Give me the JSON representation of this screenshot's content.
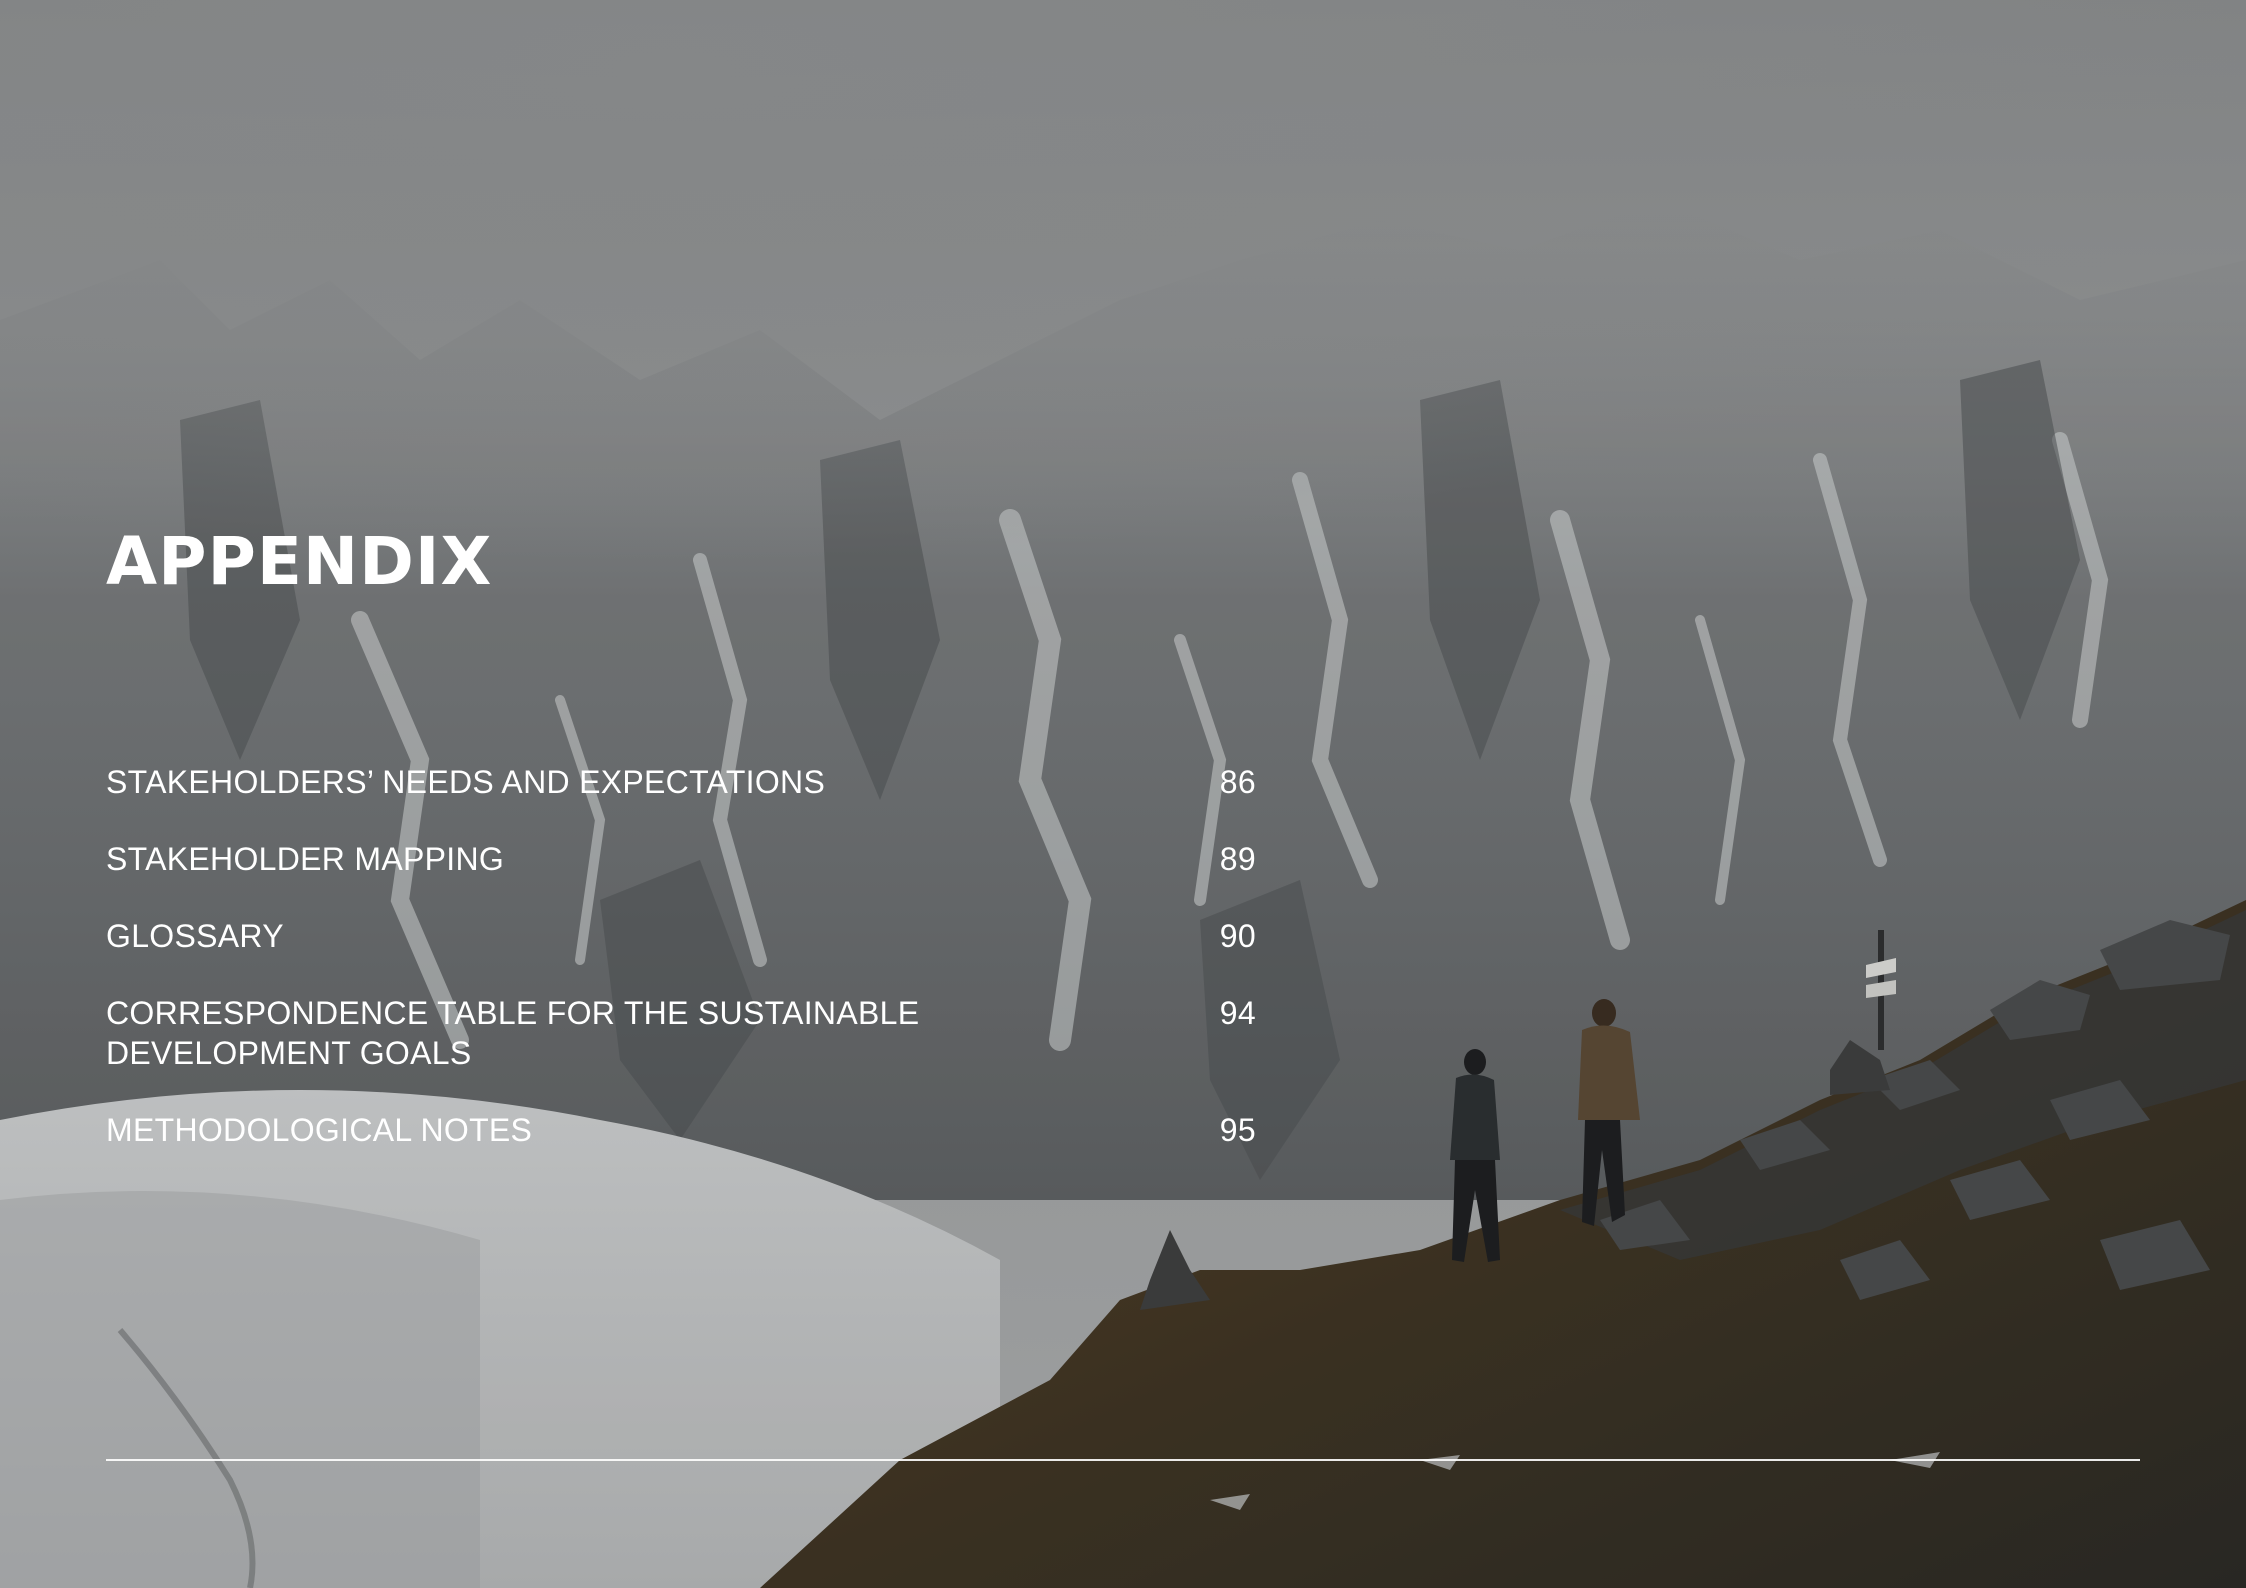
{
  "appendix": {
    "title": "APPENDIX",
    "entries": [
      {
        "label": "STAKEHOLDERS’ NEEDS AND EXPECTATIONS",
        "page": "86"
      },
      {
        "label": "STAKEHOLDER MAPPING",
        "page": "89"
      },
      {
        "label": "GLOSSARY",
        "page": "90"
      },
      {
        "label": "CORRESPONDENCE TABLE FOR THE SUSTAINABLE DEVELOPMENT GOALS",
        "page": "94"
      },
      {
        "label": "METHODOLOGICAL NOTES",
        "page": "95"
      }
    ]
  },
  "colors": {
    "text": "#ffffff",
    "fog": "#8d8f90",
    "grass": "#5a4526",
    "rock": "#3b3d3e"
  }
}
